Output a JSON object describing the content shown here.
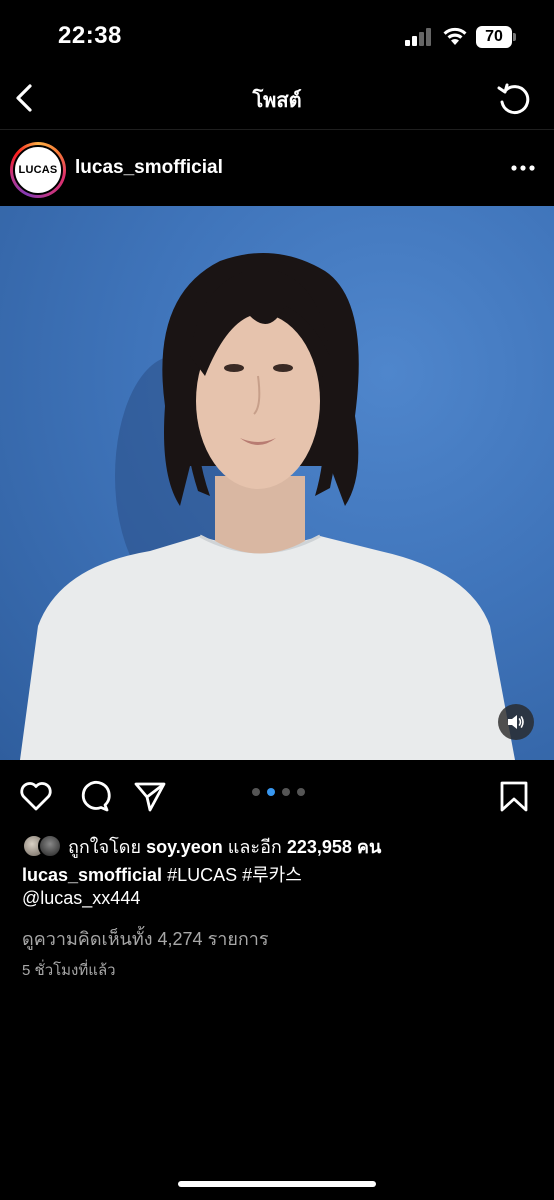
{
  "status_bar": {
    "time": "22:38",
    "battery": "70"
  },
  "nav": {
    "title": "โพสต์"
  },
  "post": {
    "avatar_text": "LUCAS",
    "username": "lucas_smofficial",
    "carousel": {
      "count": 4,
      "active_index": 1
    }
  },
  "likes": {
    "prefix": "ถูกใจโดย",
    "user": "soy.yeon",
    "middle": "และอีก",
    "count": "223,958",
    "suffix": "คน"
  },
  "caption": {
    "username": "lucas_smofficial",
    "hashtags": "#LUCAS #루카스",
    "mention": "@lucas_xx444"
  },
  "comments_link": "ดูความคิดเห็นทั้ง 4,274 รายการ",
  "time_ago": "5 ชั่วโมงที่แล้ว"
}
